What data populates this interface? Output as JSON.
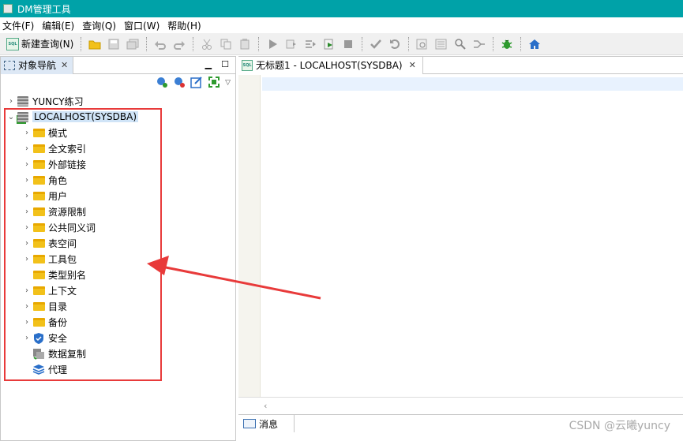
{
  "window": {
    "title": "DM管理工具"
  },
  "menubar": [
    "文件(F)",
    "编辑(E)",
    "查询(Q)",
    "窗口(W)",
    "帮助(H)"
  ],
  "toolbar": {
    "new_query_label": "新建查询(N)",
    "new_query_icon_text": "SQL"
  },
  "left_panel": {
    "tab_label": "对象导航",
    "tree": [
      {
        "label": "YUNCY练习",
        "icon": "database-icon",
        "expanded": false
      },
      {
        "label": "LOCALHOST(SYSDBA)",
        "icon": "database-connected-icon",
        "expanded": true,
        "selected": true
      },
      {
        "label": "模式",
        "icon": "folder-icon",
        "has_children": true
      },
      {
        "label": "全文索引",
        "icon": "folder-icon",
        "has_children": true
      },
      {
        "label": "外部链接",
        "icon": "folder-icon",
        "has_children": true
      },
      {
        "label": "角色",
        "icon": "folder-icon",
        "has_children": true
      },
      {
        "label": "用户",
        "icon": "folder-icon",
        "has_children": true
      },
      {
        "label": "资源限制",
        "icon": "folder-icon",
        "has_children": true
      },
      {
        "label": "公共同义词",
        "icon": "folder-icon",
        "has_children": true
      },
      {
        "label": "表空间",
        "icon": "folder-icon",
        "has_children": true
      },
      {
        "label": "工具包",
        "icon": "folder-icon",
        "has_children": true
      },
      {
        "label": "类型别名",
        "icon": "folder-icon",
        "has_children": false
      },
      {
        "label": "上下文",
        "icon": "folder-icon",
        "has_children": true
      },
      {
        "label": "目录",
        "icon": "folder-icon",
        "has_children": true
      },
      {
        "label": "备份",
        "icon": "folder-icon",
        "has_children": true
      },
      {
        "label": "安全",
        "icon": "shield-icon",
        "has_children": true
      },
      {
        "label": "数据复制",
        "icon": "replication-icon",
        "has_children": false
      },
      {
        "label": "代理",
        "icon": "layers-icon",
        "has_children": false
      }
    ]
  },
  "editor": {
    "tab_label": "无标题1 - LOCALHOST(SYSDBA)",
    "tab_icon_text": "SQL"
  },
  "message_panel": {
    "tab_label": "消息"
  },
  "watermark": "CSDN @云曦yuncy",
  "colors": {
    "titlebar": "#00a2a8",
    "annotation": "#e83a3a",
    "folder": "#f2c11a",
    "selection": "#d0e4f7"
  }
}
